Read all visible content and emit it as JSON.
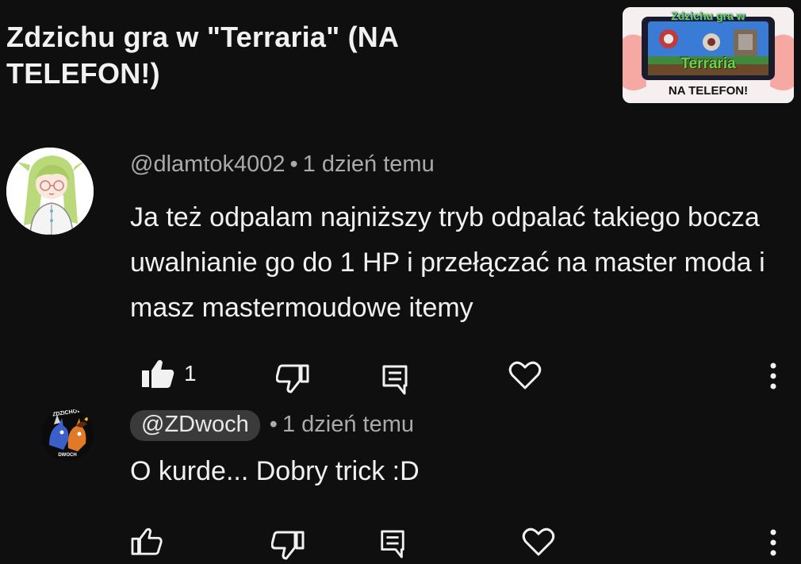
{
  "video": {
    "title": "Zdzichu gra w \"Terraria\" (NA\nTELEFON!)",
    "thumbnail": {
      "line1": "Zdzichu gra w",
      "line2": "Terraria",
      "line3": "NA TELEFON!"
    }
  },
  "comments": [
    {
      "author": "@dlamtok4002",
      "separator": "•",
      "time": "1 dzień temu",
      "text": "Ja też odpalam najniższy tryb odpalać takiego bocza uwalnianie go do 1 HP i przełączać na master moda i masz mastermoudowe itemy",
      "likes": "1",
      "liked": true,
      "avatar_icon": "anime-girl-avatar"
    },
    {
      "author": "@ZDwoch",
      "separator": "•",
      "time": "1 dzień temu",
      "text": "O kurde... Dobry trick :D",
      "likes": "",
      "liked": false,
      "avatar_icon": "zdzichow-dwoch-ponies-avatar",
      "avatar_label_top": "ZDZICHÓW",
      "avatar_label_bottom": "DWOCH"
    }
  ],
  "icons": {
    "like": "thumb-up-icon",
    "dislike": "thumb-down-icon",
    "reply": "reply-icon",
    "heart": "heart-icon",
    "more": "more-vertical-icon"
  },
  "colors": {
    "background": "#0f0f0f",
    "text": "#f1f1f1",
    "meta": "#aaaaaa",
    "pill": "#3a3a3a"
  }
}
